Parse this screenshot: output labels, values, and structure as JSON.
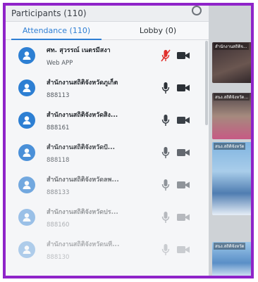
{
  "header": {
    "title": "Participants (110)"
  },
  "tabs": [
    {
      "label": "Attendance (110)",
      "active": true
    },
    {
      "label": "Lobby (0)",
      "active": false
    }
  ],
  "participants": [
    {
      "name": "ศท. สุวรรณ์ เนตรมีสงา",
      "sub": "Web APP",
      "mic": "muted-red"
    },
    {
      "name": "สำนักงานสถิติจังหวัดภูเก็ต",
      "sub": "888113",
      "mic": "on"
    },
    {
      "name": "สำนักงานสถิติจังหวัดสิง...",
      "sub": "888161",
      "mic": "on"
    },
    {
      "name": "สำนักงานสถิติจังหวัดปั...",
      "sub": "888118",
      "mic": "on"
    },
    {
      "name": "สำนักงานสถิติจังหวัดลพ...",
      "sub": "888133",
      "mic": "on"
    },
    {
      "name": "สำนักงานสถิติจังหวัดปร...",
      "sub": "888160",
      "mic": "on"
    },
    {
      "name": "สำนักงานสถิติจังหวัดนที...",
      "sub": "888130",
      "mic": "on"
    }
  ],
  "tiles": [
    {
      "label": "สำนักงานสถิติจ..."
    },
    {
      "label": "สนง.สถิติจังหวัด..."
    },
    {
      "label": "สนง.สถิติจังหวัด"
    },
    {
      "label": "สนง.สถิติจังหวัด"
    }
  ],
  "colors": {
    "accent": "#2f7fd4",
    "frame": "#8f24c9",
    "muted": "#e0302c"
  }
}
